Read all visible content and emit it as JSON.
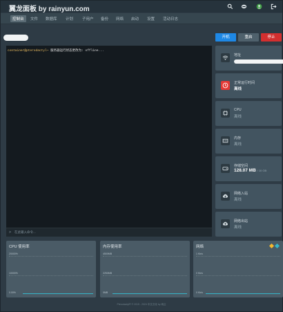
{
  "app": {
    "title": "翼龙面板 by rainyun.com"
  },
  "nav": {
    "items": [
      "控制台",
      "文件",
      "数据库",
      "计划",
      "子用户",
      "备份",
      "网络",
      "启动",
      "设置",
      "活动日志"
    ]
  },
  "controls": {
    "start_label": "开机",
    "restart_label": "重启",
    "stop_label": "停止"
  },
  "console": {
    "prompt_user": "container@pterodactyl~",
    "line_text": "服务器运行状态更改为: offline...",
    "input_prompt": ">",
    "input_placeholder": "在此输入命令..."
  },
  "stats": {
    "address_label": "地址",
    "uptime_label": "正常运行时间",
    "uptime_value": "离线",
    "cpu_label": "CPU",
    "cpu_value": "离线",
    "memory_label": "内存",
    "memory_value": "离线",
    "disk_label": "存储空间",
    "disk_value": "128.07 MB",
    "disk_limit": "/ 10 GB",
    "net_in_label": "网络入站",
    "net_in_value": "离线",
    "net_out_label": "网络出站",
    "net_out_value": "离线"
  },
  "charts": {
    "cpu": {
      "title": "CPU 使用率",
      "ticks": [
        "20000%",
        "10000%",
        "0.00%"
      ]
    },
    "memory": {
      "title": "内存使用率",
      "ticks": [
        "4500MB",
        "2250MB",
        "0MB"
      ]
    },
    "network": {
      "title": "网络",
      "ticks": [
        "1 Kb/s",
        "0 Kb/s",
        "0 Kb/s"
      ]
    }
  },
  "colors": {
    "accent_blue": "#1e88e5",
    "stop_red": "#d32f2f",
    "legend_in": "#f5b82e",
    "legend_out": "#35b6c9"
  },
  "footer": {
    "text": "Pterodactyl® © 2015 - 2024 中文汉化 by 雨云"
  }
}
